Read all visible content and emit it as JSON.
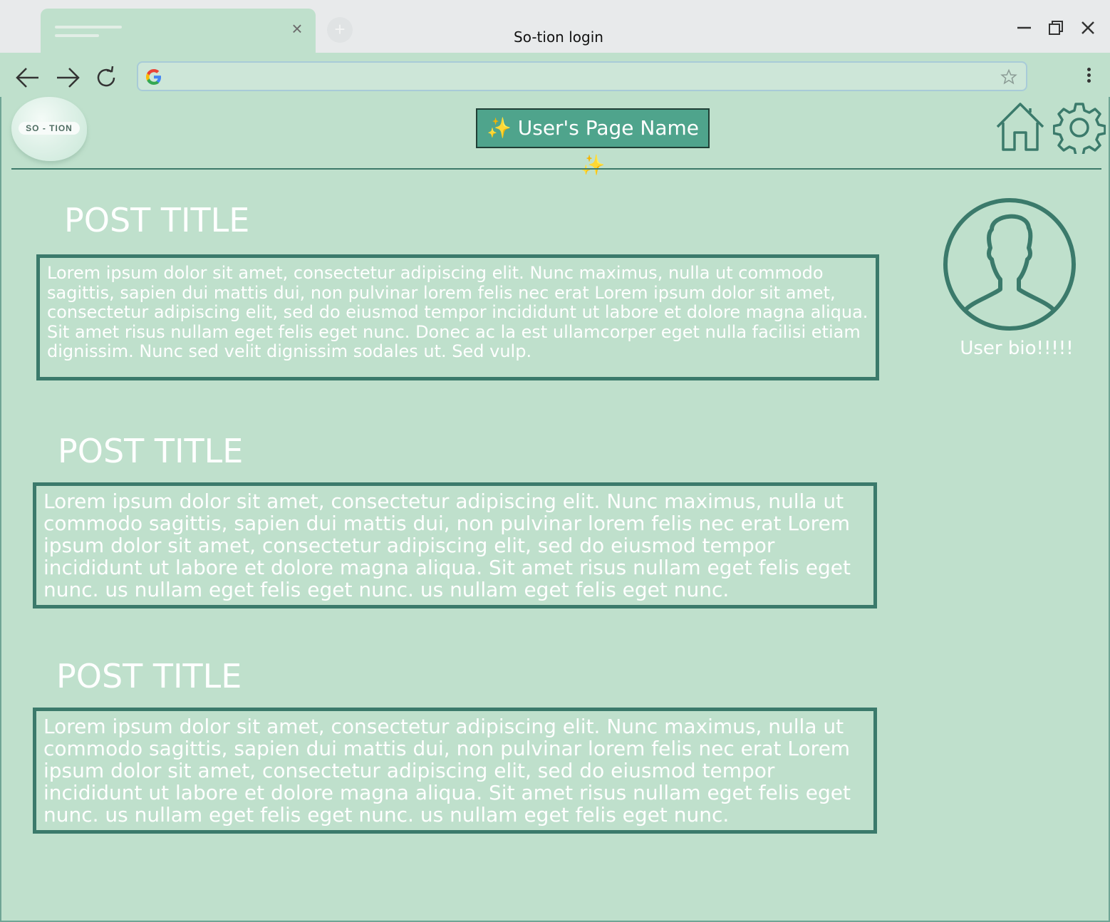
{
  "window": {
    "title": "So-tion login",
    "tab_close": "×",
    "new_tab": "+"
  },
  "page": {
    "logo_text": "SO - TION",
    "page_name": "✨ User's Page Name ✨",
    "user_bio": "User bio!!!!!"
  },
  "posts": [
    {
      "title": "POST TITLE",
      "body": "Lorem ipsum dolor sit amet, consectetur adipiscing elit. Nunc maximus, nulla ut commodo sagittis, sapien dui mattis dui, non pulvinar lorem felis nec erat Lorem ipsum dolor sit amet, consectetur adipiscing elit, sed do eiusmod tempor incididunt ut labore et dolore magna aliqua. Sit amet risus nullam eget felis eget nunc. Donec ac la est ullamcorper eget nulla facilisi etiam dignissim. Nunc sed velit dignissim sodales ut. Sed vulp."
    },
    {
      "title": "POST TITLE",
      "body": "Lorem ipsum dolor sit amet, consectetur adipiscing elit. Nunc maximus, nulla ut commodo sagittis, sapien dui mattis dui, non pulvinar lorem felis nec erat Lorem ipsum dolor sit amet, consectetur adipiscing elit, sed do eiusmod tempor incididunt ut labore et dolore magna aliqua. Sit amet risus nullam eget felis eget nunc. us nullam eget felis eget nunc. us nullam eget felis eget nunc."
    },
    {
      "title": "POST TITLE",
      "body": "Lorem ipsum dolor sit amet, consectetur adipiscing elit. Nunc maximus, nulla ut commodo sagittis, sapien dui mattis dui, non pulvinar lorem felis nec erat Lorem ipsum dolor sit amet, consectetur adipiscing elit, sed do eiusmod tempor incididunt ut labore et dolore magna aliqua. Sit amet risus nullam eget felis eget nunc. us nullam eget felis eget nunc. us nullam eget felis eget nunc."
    }
  ],
  "icons": {
    "back": "back-arrow-icon",
    "forward": "forward-arrow-icon",
    "reload": "reload-icon",
    "google": "google-icon",
    "bookmark": "star-icon",
    "menu": "kebab-menu-icon",
    "home": "home-icon",
    "settings": "gear-icon",
    "avatar": "user-avatar-icon"
  },
  "colors": {
    "page_background": "#bfe0cc",
    "accent": "#4fa48c",
    "border": "#3b7a6b",
    "titlebar": "#e8eaeb"
  }
}
